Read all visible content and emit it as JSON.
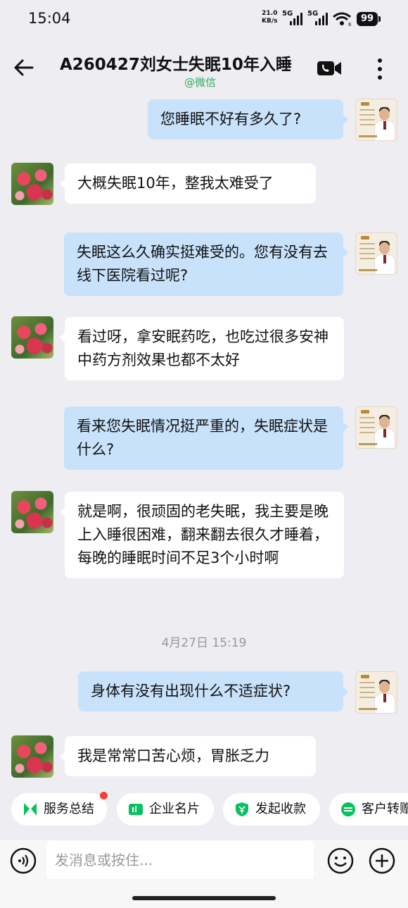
{
  "status_bar": {
    "time": "15:04",
    "net_speed": "21.0",
    "net_unit": "KB/s",
    "sig1_label": "5G",
    "sig2_label": "5G",
    "wifi_badge": "6",
    "battery": "99"
  },
  "header": {
    "title": "A260427刘女士失眠10年入睡",
    "subtitle": "@微信",
    "icons": {
      "back": "arrow-left-icon",
      "call": "video-call-icon",
      "more": "more-vertical-icon"
    }
  },
  "messages": [
    {
      "side": "out",
      "text": "您睡眠不好有多久了?"
    },
    {
      "side": "in",
      "text": "大概失眠10年，整我太难受了"
    },
    {
      "side": "out",
      "text": "失眠这么久确实挺难受的。您有没有去线下医院看过呢?"
    },
    {
      "side": "in",
      "text": "看过呀，拿安眠药吃，也吃过很多安神中药方剂效果也都不太好"
    },
    {
      "side": "out",
      "text": "看来您失眠情况挺严重的，失眠症状是什么?"
    },
    {
      "side": "in",
      "text": "就是啊，很顽固的老失眠，我主要是晚上入睡很困难，翻来翻去很久才睡着，每晚的睡眠时间不足3个小时啊"
    },
    {
      "side": "out",
      "text": "身体有没有出现什么不适症状?"
    },
    {
      "side": "in",
      "text": "我是常常口苦心烦，胃胀乏力"
    }
  ],
  "timestamp": "4月27日 15:19",
  "quick_actions": [
    {
      "label": "服务总结",
      "icon": "bookmark-icon",
      "color": "#07c160",
      "has_dot": true
    },
    {
      "label": "企业名片",
      "icon": "card-icon",
      "color": "#07c160"
    },
    {
      "label": "发起收款",
      "icon": "yen-shield-icon",
      "color": "#07c160"
    },
    {
      "label": "客户转赠",
      "icon": "transfer-icon",
      "color": "#07c160"
    }
  ],
  "input": {
    "placeholder": "发消息或按住..."
  },
  "colors": {
    "background": "#ededf2",
    "outgoing_bubble": "#c8e2fb",
    "incoming_bubble": "#ffffff",
    "accent_green": "#2fae5a"
  }
}
